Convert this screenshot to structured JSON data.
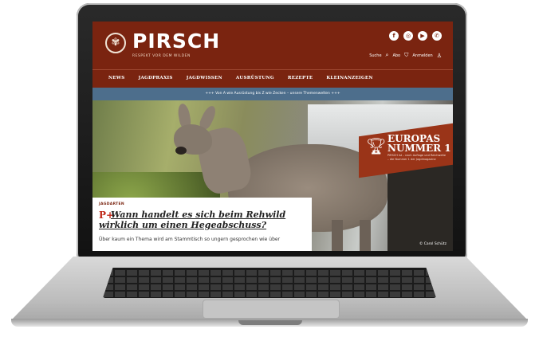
{
  "site": {
    "logo_text": "PIRSCH",
    "tagline": "RESPEKT VOR DEM WILDEN",
    "socials": [
      {
        "icon": "facebook-icon",
        "glyph": "f"
      },
      {
        "icon": "instagram-icon",
        "glyph": "◎"
      },
      {
        "icon": "youtube-icon",
        "glyph": "▶"
      },
      {
        "icon": "whatsapp-icon",
        "glyph": "✆"
      }
    ],
    "util": {
      "search_label": "Suche",
      "abo_label": "Abo",
      "login_label": "Anmelden"
    },
    "nav": [
      "NEWS",
      "JAGDPRAXIS",
      "JAGDWISSEN",
      "AUSRÜSTUNG",
      "REZEPTE",
      "KLEINANZEIGEN"
    ],
    "banner": "+++ Von A wie Ausrüstung bis Z wie Zecken – unsere Themenwelten +++",
    "badge": {
      "title_line1": "EUROPAS",
      "title_line2": "NUMMER 1",
      "sub": "PIRSCH ist – nach Auflage und Reichweite – die Nummer 1 der Jagdmagazine"
    },
    "article": {
      "kicker": "JAGDARTEN",
      "plus_mark": "P+",
      "headline": "Wann handelt es sich beim Rehwild wirklich um einen Hegeabschuss?",
      "excerpt": "Über kaum ein Thema wird am Stammtisch so ungern gesprochen wie über"
    },
    "photo_credit": "© Carol Schütz"
  },
  "colors": {
    "brand": "#7a2410",
    "banner": "#4d6e8c",
    "plus": "#c0291a"
  }
}
